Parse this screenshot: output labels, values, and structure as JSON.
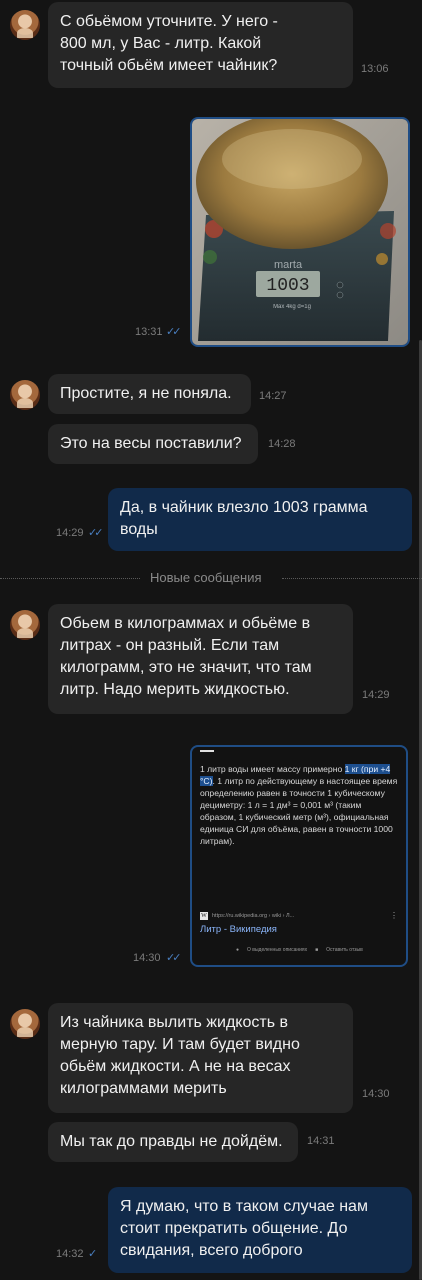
{
  "messages": {
    "m1": {
      "text": "С обьёмом уточните. У него - 800 мл, у Вас - литр. Какой точный обьём имеет чайник?",
      "time": "13:06"
    },
    "photo": {
      "time": "13:31",
      "scale_brand": "marta",
      "scale_display": "1003",
      "scale_caption": "Max 4kg d=1g"
    },
    "m2": {
      "text": "Простите, я не поняла.",
      "time": "14:27"
    },
    "m3": {
      "text": "Это на весы поставили?",
      "time": "14:28"
    },
    "m4": {
      "text": "Да, в чайник влезло 1003 грамма воды",
      "time": "14:29"
    },
    "divider": "Новые сообщения",
    "m5": {
      "text": "Обьем в килограммах и обьёме в литрах - он разный. Если там килограмм, это не значит, что там литр. Надо мерить жидкостью.",
      "time": "14:29"
    },
    "wiki": {
      "time": "14:30",
      "text_before": "1 литр воды имеет массу примерно ",
      "highlight": "1 кг (при +4 °C)",
      "text_after": ". 1 литр по действующему в настоящее время определению равен в точности 1 кубическому дециметру: 1 л = 1 дм³ = 0,001 м³ (таким образом, 1 кубический метр (м³), официальная единица СИ для объёма, равен в точности 1000 литрам).",
      "url": "https://ru.wikipedia.org › wiki › Л...",
      "title": "Литр - Википедия",
      "about": "О выделенных описаниях",
      "feedback": "Оставить отзыв"
    },
    "m6": {
      "text": "Из чайника вылить жидкость в мерную тару. И там будет видно обьём жидкости. А не  на весах килограммами мерить",
      "time": "14:30"
    },
    "m7": {
      "text": "Мы так до правды не дойдём.",
      "time": "14:31"
    },
    "m8": {
      "text": "Я думаю, что в таком случае нам стоит прекратить общение. До свидания, всего доброго",
      "time": "14:32"
    }
  }
}
